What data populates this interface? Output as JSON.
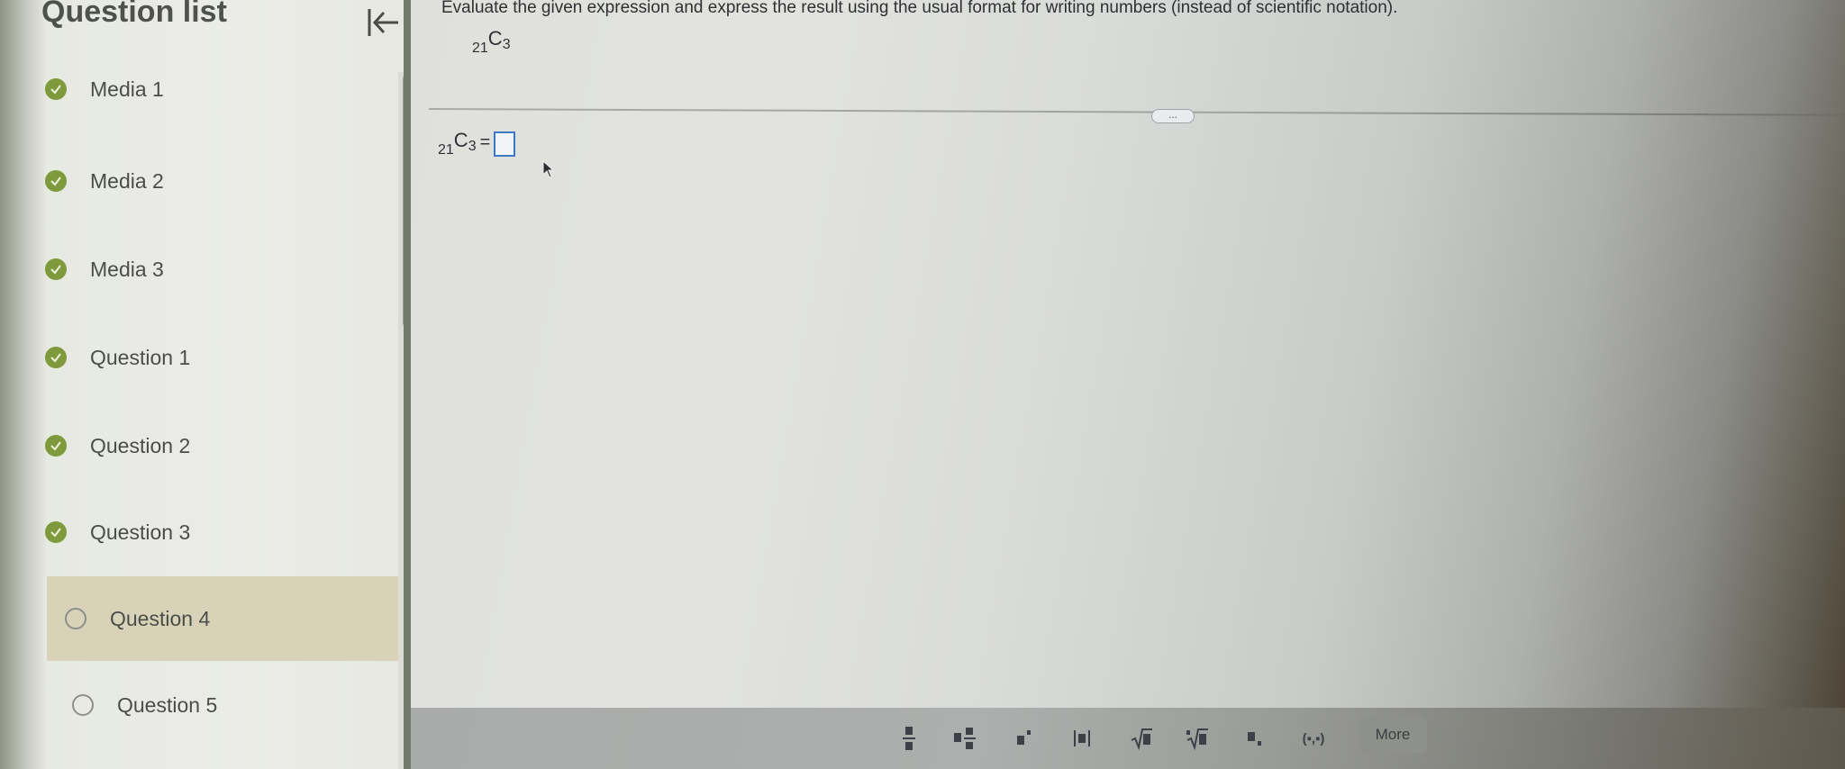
{
  "sidebar": {
    "title": "Question list",
    "items": [
      {
        "label": "Media 1",
        "status": "done"
      },
      {
        "label": "Media 2",
        "status": "done"
      },
      {
        "label": "Media 3",
        "status": "done"
      },
      {
        "label": "Question 1",
        "status": "done"
      },
      {
        "label": "Question 2",
        "status": "done"
      },
      {
        "label": "Question 3",
        "status": "done"
      },
      {
        "label": "Question 4",
        "status": "todo"
      },
      {
        "label": "Question 5",
        "status": "todo"
      }
    ],
    "collapse_icon": "collapse-left-icon"
  },
  "question": {
    "instructions": "Evaluate the given expression and express the result using the usual format for writing numbers (instead of scientific notation).",
    "expression": {
      "n": "21",
      "c": "C",
      "r": "3"
    },
    "answer": {
      "n": "21",
      "c": "C",
      "r": "3",
      "eq": "=",
      "value": ""
    },
    "more_dots": "..."
  },
  "toolbar": {
    "buttons": [
      {
        "icon": "fraction-icon"
      },
      {
        "icon": "mixed-number-icon"
      },
      {
        "icon": "exponent-icon"
      },
      {
        "icon": "absolute-value-icon"
      },
      {
        "icon": "square-root-icon"
      },
      {
        "icon": "nth-root-icon"
      },
      {
        "icon": "subscript-icon"
      },
      {
        "icon": "ordered-pair-icon"
      }
    ],
    "ordered_pair_label": "(▪,▪)",
    "more_label": "More"
  },
  "colors": {
    "complete": "#7e9a3c",
    "active_item": "#d8d3b8",
    "answer_box_border": "#3d78c7"
  }
}
